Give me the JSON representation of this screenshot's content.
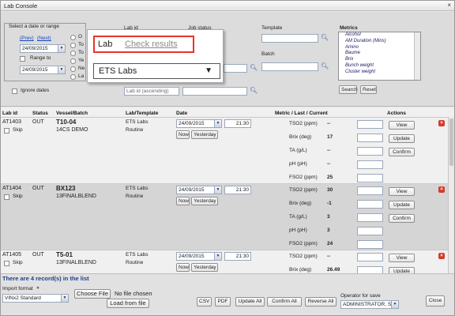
{
  "window": {
    "title": "Lab Console",
    "close_glyph": "×"
  },
  "filter": {
    "date_group_label": "Select a date or range",
    "prev_label": "(Prev)",
    "next_label": "(Next)",
    "date_from": "24/09/2015",
    "range_to_label": "Range to",
    "date_to": "24/09/2015",
    "radio_fragments": [
      "O",
      "To",
      "To",
      "Ye",
      "Ne",
      "La"
    ],
    "ignore_dates_label": "Ignore dates",
    "lab_id_label": "Lab id",
    "job_status_label": "Job status",
    "template_label": "Template",
    "batch_label": "Batch",
    "sort_value": "Lab id (ascending)",
    "metrics_label": "Metrics",
    "metrics": [
      "Alcohol",
      "AM Duration (Mins)",
      "Amino",
      "Baume",
      "Brix",
      "Bunch weight",
      "Cluster weight"
    ],
    "search_label": "Search",
    "reset_label": "Reset"
  },
  "popup": {
    "lab_label": "Lab",
    "check_results_label": "Check results",
    "lab_select_value": "ETS Labs"
  },
  "grid": {
    "headers": {
      "lab_id": "Lab id",
      "status": "Status",
      "vessel": "Vessel/Batch",
      "lab_template": "Lab/Template",
      "date": "Date",
      "metric": "Metric / Last / Current",
      "actions": "Actions"
    },
    "skip_label": "Skip",
    "now_label": "Now",
    "yesterday_label": "Yesterday",
    "view_label": "View",
    "update_label": "Update",
    "confirm_label": "Confirm",
    "delete_glyph": "×",
    "rows": [
      {
        "lab_id": "AT1403",
        "status": "OUT",
        "vessel": "T10-04",
        "batch": "14CS DEMO",
        "lab": "ETS Labs",
        "template": "Routine",
        "date": "24/09/2015",
        "time": "21:30",
        "metrics": [
          {
            "name": "TSO2 (ppm)",
            "last": "--"
          },
          {
            "name": "Brix (deg)",
            "last": "17"
          },
          {
            "name": "TA (g/L)",
            "last": "--"
          },
          {
            "name": "pH (pH)",
            "last": "--"
          },
          {
            "name": "FSO2 (ppm)",
            "last": "25"
          }
        ]
      },
      {
        "lab_id": "AT1404",
        "status": "OUT",
        "vessel": "BX123",
        "batch": "13FINALBLEND",
        "lab": "ETS Labs",
        "template": "Routine",
        "date": "24/09/2015",
        "time": "21:30",
        "metrics": [
          {
            "name": "TSO2 (ppm)",
            "last": "30"
          },
          {
            "name": "Brix (deg)",
            "last": "-1"
          },
          {
            "name": "TA (g/L)",
            "last": "3"
          },
          {
            "name": "pH (pH)",
            "last": "3"
          },
          {
            "name": "FSO2 (ppm)",
            "last": "24"
          }
        ]
      },
      {
        "lab_id": "AT1405",
        "status": "OUT",
        "vessel": "T5-01",
        "batch": "13FINALBLEND",
        "lab": "ETS Labs",
        "template": "Routine",
        "date": "24/09/2015",
        "time": "21:30",
        "metrics": [
          {
            "name": "TSO2 (ppm)",
            "last": "--"
          },
          {
            "name": "Brix (deg)",
            "last": "26.49"
          }
        ]
      }
    ]
  },
  "footer": {
    "record_count": "There are 4 record(s) in the list",
    "import_format_label": "Import format",
    "import_format_value": "VINx2 Standard",
    "choose_file_label": "Choose File",
    "no_file_label": "No file chosen",
    "load_from_file_label": "Load from file",
    "csv_label": "CSV",
    "pdf_label": "PDF",
    "update_all_label": "Update All",
    "confirm_all_label": "Confirm All",
    "reverse_all_label": "Reverse All",
    "operator_label": "Operator for save",
    "operator_value": "ADMINISTRATOR, S",
    "close_label": "Close"
  },
  "colors": {
    "accent_red": "#e6352a",
    "link_blue": "#1a44c2",
    "count_blue": "#1f3f8f"
  }
}
